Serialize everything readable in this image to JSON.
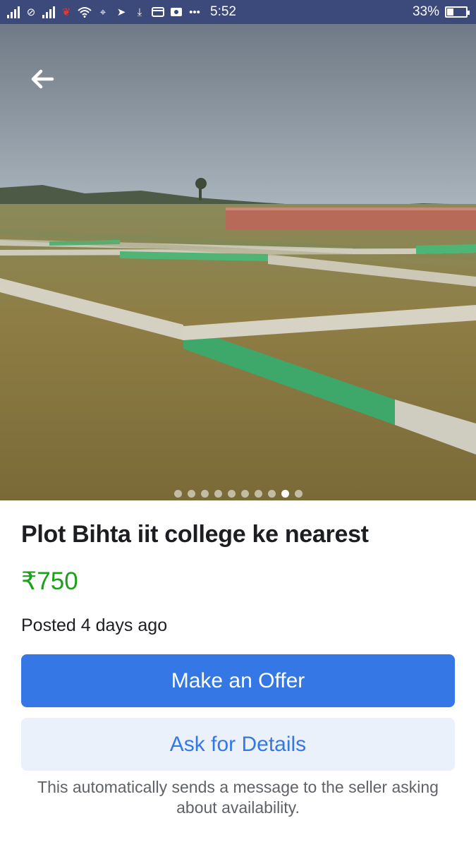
{
  "status_bar": {
    "time": "5:52",
    "battery": "33%",
    "battery_level": 0.33,
    "icons": [
      "signal-icon",
      "network-icon",
      "signal-icon",
      "app-icon",
      "wifi-icon",
      "location-icon",
      "send-icon",
      "download-icon",
      "card-icon",
      "photo-icon",
      "more-icon"
    ]
  },
  "nav": {
    "back_icon": "arrow-left-icon"
  },
  "gallery": {
    "image_count": 10,
    "active_index": 8
  },
  "listing": {
    "title": "Plot Bihta iit college ke nearest",
    "price": "₹750",
    "posted": "Posted 4 days ago"
  },
  "actions": {
    "offer_label": "Make an Offer",
    "ask_label": "Ask for Details",
    "note": "This automatically sends a message to the seller asking about availability."
  },
  "colors": {
    "status_bar": "#3b4a7a",
    "primary": "#3578e5",
    "secondary_bg": "#ebf1fb",
    "price": "#1aa01a"
  }
}
